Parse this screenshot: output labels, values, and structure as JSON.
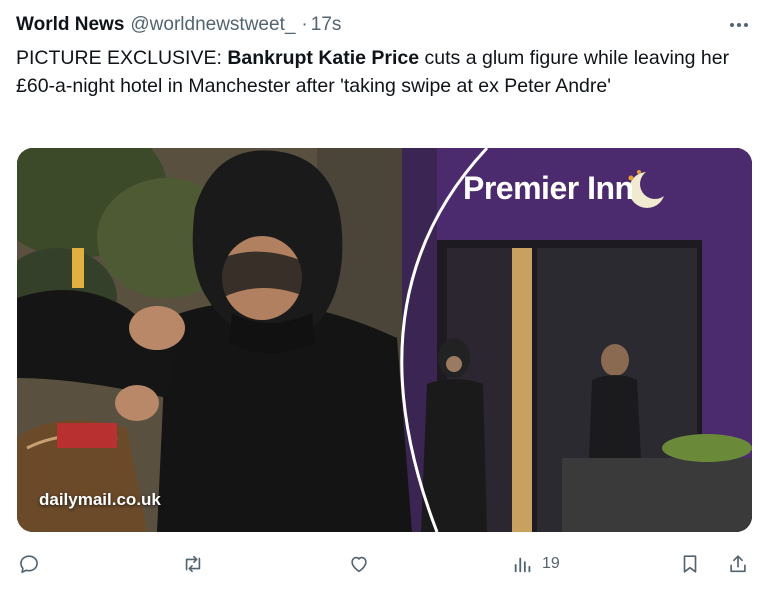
{
  "author": {
    "display_name": "World News",
    "handle": "@worldnewstweet_",
    "separator": "·",
    "time": "17s"
  },
  "icons": {
    "more": "more-horizontal-icon",
    "reply": "reply-icon",
    "repost": "repost-icon",
    "like": "like-icon",
    "views": "views-icon",
    "bookmark": "bookmark-icon",
    "share": "share-icon"
  },
  "tweet": {
    "part1": "PICTURE EXCLUSIVE: ",
    "part2": "Bankrupt Katie Price",
    "part3": " cuts a glum figure while leaving her £60-a-night hotel in Manchester after 'taking swipe at ex Peter Andre'"
  },
  "media": {
    "watermark": "dailymail.co.uk",
    "sign_text": "Premier Inn"
  },
  "actions": {
    "views_count": "19"
  },
  "colors": {
    "text_primary": "#0f1419",
    "text_secondary": "#536471",
    "premier_purple": "#4b2a6e"
  }
}
